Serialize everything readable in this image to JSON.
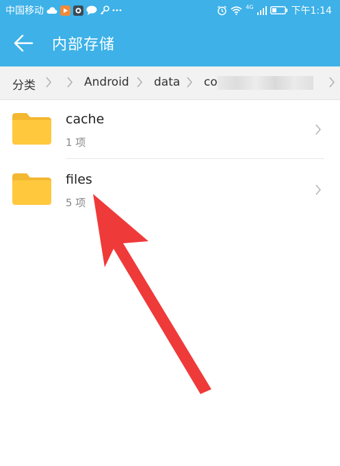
{
  "status_bar": {
    "carrier": "中国移动",
    "signal_label": "4G",
    "time": "下午1:14"
  },
  "header": {
    "title": "内部存储"
  },
  "breadcrumb": {
    "items": [
      "分类",
      "Android",
      "data",
      "co"
    ]
  },
  "files": [
    {
      "name": "cache",
      "count": "1 项",
      "icon": "folder-icon"
    },
    {
      "name": "files",
      "count": "5 项",
      "icon": "folder-icon"
    }
  ],
  "colors": {
    "accent": "#3db1e8",
    "folder": "#ffc83d",
    "annotation_arrow": "#ef3a3a"
  }
}
